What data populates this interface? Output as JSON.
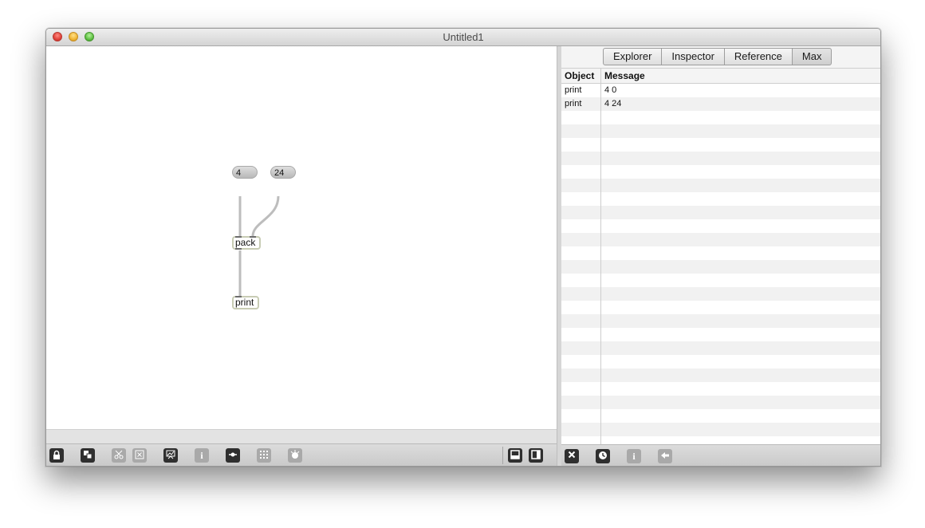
{
  "window": {
    "title": "Untitled1"
  },
  "patcher": {
    "objects": {
      "number_left": "4",
      "number_right": "24",
      "pack": "pack",
      "print": "print"
    }
  },
  "console": {
    "tabs": [
      {
        "label": "Explorer",
        "active": false
      },
      {
        "label": "Inspector",
        "active": false
      },
      {
        "label": "Reference",
        "active": false
      },
      {
        "label": "Max",
        "active": true
      }
    ],
    "columns": {
      "object": "Object",
      "message": "Message"
    },
    "rows": [
      {
        "object": "print",
        "message": "4 0"
      },
      {
        "object": "print",
        "message": "4 24"
      }
    ]
  },
  "toolbar_icons": {
    "patcher": [
      "lock-icon",
      "new-object-icon",
      "cut-icon",
      "clear-icon",
      "presentation-icon",
      "info-icon",
      "object-palette-icon",
      "grid-icon",
      "debug-icon",
      "split-horizontal-icon",
      "split-vertical-icon"
    ],
    "console": [
      "clear-console-icon",
      "timestamp-icon",
      "info-icon",
      "back-arrow-icon"
    ]
  },
  "colors": {
    "object_border": "#c8ccb4",
    "patch_cord": "#bdbdbd"
  }
}
